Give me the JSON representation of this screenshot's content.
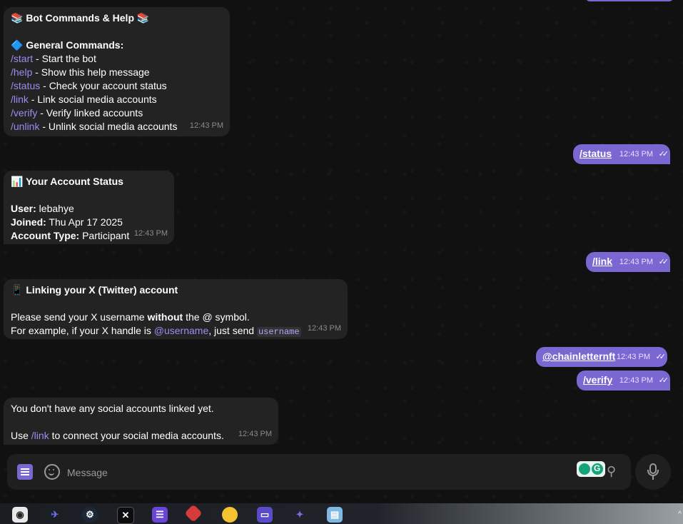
{
  "colors": {
    "outgoing_bubble": "#7a67d2",
    "incoming_bubble": "#232323",
    "command_link": "#9f8cf0",
    "background": "#111111"
  },
  "messages": {
    "help": {
      "title": "📚 Bot Commands & Help 📚",
      "section": "🔷 General Commands:",
      "commands": [
        {
          "cmd": "/start",
          "desc": " - Start the bot"
        },
        {
          "cmd": "/help",
          "desc": " - Show this help message"
        },
        {
          "cmd": "/status",
          "desc": " - Check your account status"
        },
        {
          "cmd": "/link",
          "desc": " - Link social media accounts"
        },
        {
          "cmd": "/verify",
          "desc": " - Verify linked accounts"
        },
        {
          "cmd": "/unlink",
          "desc": " - Unlink social media accounts"
        }
      ],
      "time": "12:43 PM"
    },
    "out_status": {
      "text": "/status",
      "time": "12:43 PM"
    },
    "status": {
      "title": "📊 Your Account Status",
      "user_label": "User:",
      "user_value": " lebahye",
      "joined_label": "Joined:",
      "joined_value": " Thu Apr 17 2025",
      "type_label": "Account Type:",
      "type_value": " Participant",
      "time": "12:43 PM"
    },
    "out_link": {
      "text": "/link",
      "time": "12:43 PM"
    },
    "linking": {
      "title": "📱 Linking your X (Twitter) account",
      "line1_a": "Please send your X username ",
      "line1_b": "without",
      "line1_c": " the @ symbol.",
      "line2_a": "For example, if your X handle is ",
      "line2_handle": "@username",
      "line2_b": ", just send ",
      "line2_code": "username",
      "time": "12:43 PM"
    },
    "out_handle": {
      "text": "@chainletternft",
      "time": "12:43 PM"
    },
    "out_verify": {
      "text": "/verify",
      "time": "12:43 PM"
    },
    "no_accounts": {
      "line1": "You don't have any social accounts linked yet.",
      "line2_a": "Use ",
      "line2_cmd": "/link",
      "line2_b": " to connect your social media accounts.",
      "time": "12:43 PM"
    }
  },
  "composer": {
    "placeholder": "Message",
    "menu_icon": "menu-icon",
    "emoji_icon": "emoji-icon",
    "attach_icon": "paperclip-icon",
    "mic_icon": "microphone-icon"
  },
  "taskbar": {
    "icons": [
      "app-icon-1",
      "app-icon-2",
      "steam-icon",
      "app-icon-4",
      "app-icon-5",
      "app-icon-6",
      "app-icon-7",
      "app-icon-8",
      "app-icon-9",
      "app-icon-10"
    ],
    "caret": "^"
  }
}
